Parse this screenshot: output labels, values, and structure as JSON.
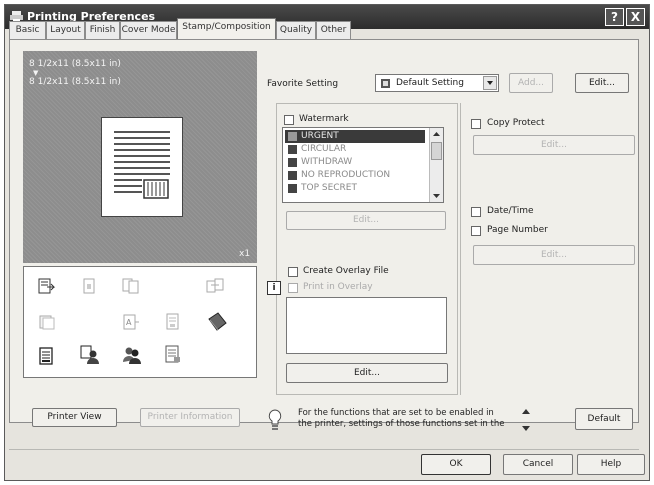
{
  "window": {
    "title": "Printing Preferences",
    "help_btn": "?",
    "close_btn": "X"
  },
  "tabs": [
    {
      "label": "Basic",
      "active": false
    },
    {
      "label": "Layout",
      "active": false
    },
    {
      "label": "Finish",
      "active": false
    },
    {
      "label": "Cover Mode",
      "active": false
    },
    {
      "label": "Stamp/Composition",
      "active": true
    },
    {
      "label": "Quality",
      "active": false
    },
    {
      "label": "Other",
      "active": false
    }
  ],
  "preview": {
    "paper_line1": "8 1/2x11 (8.5x11 in)",
    "arrow": "▼",
    "paper_line2": "8 1/2x11 (8.5x11 in)",
    "copies": "x1"
  },
  "left_buttons": {
    "printer_view": "Printer View",
    "printer_info": "Printer Information"
  },
  "favorite": {
    "label": "Favorite Setting",
    "selected": "Default Setting",
    "add": "Add...",
    "edit": "Edit..."
  },
  "watermark": {
    "label": "Watermark",
    "items": [
      "URGENT",
      "CIRCULAR",
      "WITHDRAW",
      "NO REPRODUCTION",
      "TOP SECRET"
    ],
    "edit": "Edit..."
  },
  "overlay": {
    "create_label": "Create Overlay File",
    "print_label": "Print in Overlay",
    "info_icon": "i",
    "edit": "Edit..."
  },
  "copy_protect": {
    "label": "Copy Protect",
    "edit": "Edit..."
  },
  "date_page": {
    "date_label": "Date/Time",
    "page_label": "Page Number",
    "edit": "Edit..."
  },
  "info": {
    "line1": "For the functions that are set to be enabled in",
    "line2": "the printer, settings of those functions set in the"
  },
  "default_btn": "Default",
  "dialog_buttons": {
    "ok": "OK",
    "cancel": "Cancel",
    "help": "Help"
  },
  "colors": {
    "titlebar": "#3a3a3a",
    "dialog_bg": "#e6e4de",
    "preview_bg": "#8d8d8d",
    "selection": "#3a3a3a"
  }
}
